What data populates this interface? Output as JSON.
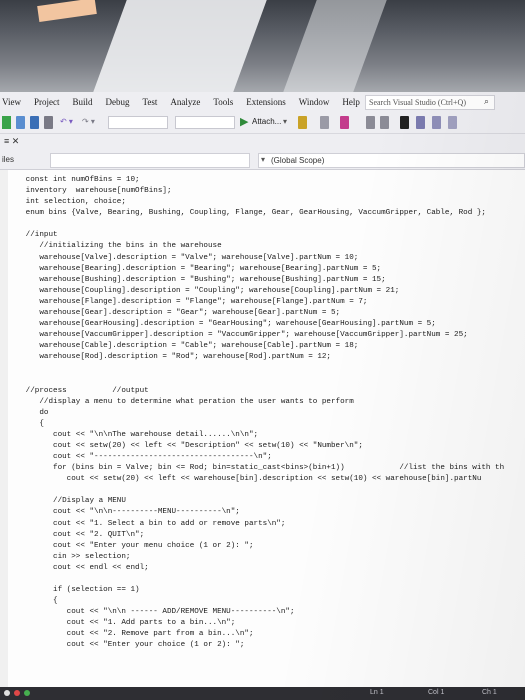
{
  "menu": {
    "items": [
      "View",
      "Project",
      "Build",
      "Debug",
      "Test",
      "Analyze",
      "Tools",
      "Extensions",
      "Window",
      "Help"
    ],
    "search_placeholder": "Search Visual Studio (Ctrl+Q)"
  },
  "toolbar": {
    "attach_label": "Attach..."
  },
  "tabs": {
    "files_label": "iles"
  },
  "navbar": {
    "scope": "(Global Scope)"
  },
  "code": [
    "   const int numOfBins = 10;",
    "   inventory  warehouse[numOfBins];",
    "   int selection, choice;",
    "   enum bins {Valve, Bearing, Bushing, Coupling, Flange, Gear, GearHousing, VaccumGripper, Cable, Rod };",
    "",
    "   //input",
    "      //initializing the bins in the warehouse",
    "      warehouse[Valve].description = \"Valve\"; warehouse[Valve].partNum = 10;",
    "      warehouse[Bearing].description = \"Bearing\"; warehouse[Bearing].partNum = 5;",
    "      warehouse[Bushing].description = \"Bushing\"; warehouse[Bushing].partNum = 15;",
    "      warehouse[Coupling].description = \"Coupling\"; warehouse[Coupling].partNum = 21;",
    "      warehouse[Flange].description = \"Flange\"; warehouse[Flange].partNum = 7;",
    "      warehouse[Gear].description = \"Gear\"; warehouse[Gear].partNum = 5;",
    "      warehouse[GearHousing].description = \"GearHousing\"; warehouse[GearHousing].partNum = 5;",
    "      warehouse[VaccumGripper].description = \"VaccumGripper\"; warehouse[VaccumGripper].partNum = 25;",
    "      warehouse[Cable].description = \"Cable\"; warehouse[Cable].partNum = 18;",
    "      warehouse[Rod].description = \"Rod\"; warehouse[Rod].partNum = 12;",
    "",
    "",
    "   //process          //output",
    "      //display a menu to determine what peration the user wants to perform",
    "      do",
    "      {",
    "         cout << \"\\n\\nThe warehouse detail......\\n\\n\";",
    "         cout << setw(20) << left << \"Description\" << setw(10) << \"Number\\n\";",
    "         cout << \"-----------------------------------\\n\";",
    "         for (bins bin = Valve; bin <= Rod; bin=static_cast<bins>(bin+1))            //list the bins with th",
    "            cout << setw(20) << left << warehouse[bin].description << setw(10) << warehouse[bin].partNu",
    "",
    "         //Display a MENU",
    "         cout << \"\\n\\n----------MENU----------\\n\";",
    "         cout << \"1. Select a bin to add or remove parts\\n\";",
    "         cout << \"2. QUIT\\n\";",
    "         cout << \"Enter your menu choice (1 or 2): \";",
    "         cin >> selection;",
    "         cout << endl << endl;",
    "",
    "         if (selection == 1)",
    "         {",
    "            cout << \"\\n\\n ------ ADD/REMOVE MENU----------\\n\";",
    "            cout << \"1. Add parts to a bin...\\n\";",
    "            cout << \"2. Remove part from a bin...\\n\";",
    "            cout << \"Enter your choice (1 or 2): \";"
  ],
  "status": {
    "line": "Ln 1",
    "col": "Col 1",
    "ch": "Ch 1"
  }
}
